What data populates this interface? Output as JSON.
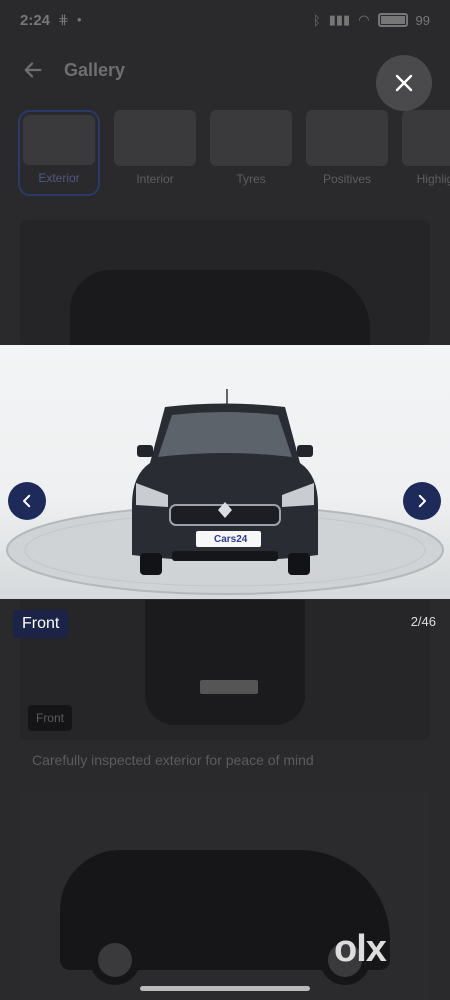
{
  "status_bar": {
    "time": "2:24",
    "battery": "99"
  },
  "header": {
    "title": "Gallery"
  },
  "thumbnails": [
    {
      "label": "Exterior",
      "active": true
    },
    {
      "label": "Interior",
      "active": false
    },
    {
      "label": "Tyres",
      "active": false
    },
    {
      "label": "Positives",
      "active": false
    },
    {
      "label": "Highlights",
      "active": false
    }
  ],
  "viewer": {
    "plate_text": "Cars24",
    "current_label": "Front",
    "counter": "2/46"
  },
  "background": {
    "tag": "Front",
    "caption": "Carefully inspected exterior for peace of mind"
  },
  "branding": {
    "watermark": "olx"
  },
  "colors": {
    "nav_button": "#1e2a5a",
    "label_bg": "#1b2346",
    "overlay": "#1d1d1f"
  }
}
